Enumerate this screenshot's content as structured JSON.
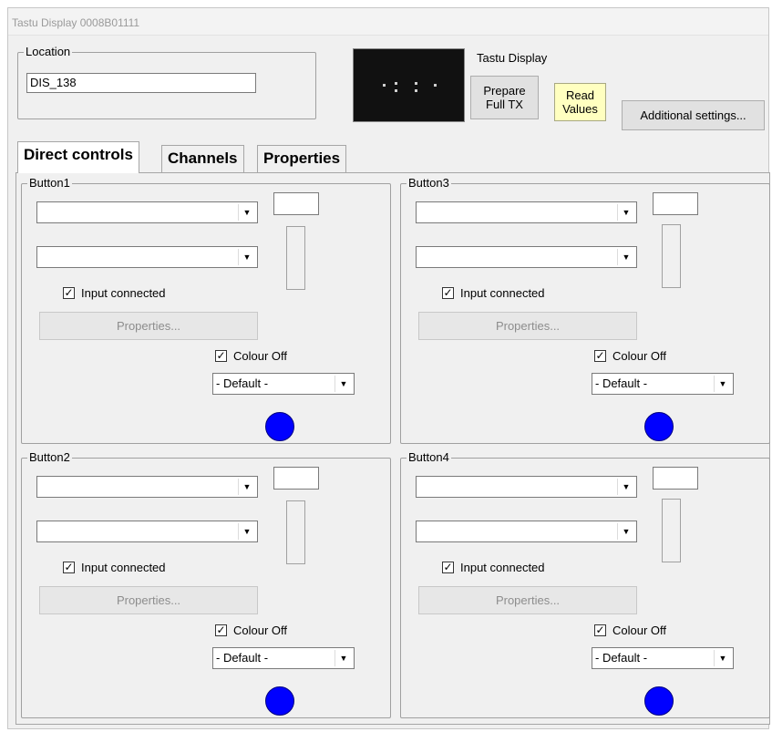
{
  "window": {
    "title": "Tastu Display 0008B01111"
  },
  "location": {
    "group_label": "Location",
    "value": "DIS_138"
  },
  "device": {
    "label": "Tastu Display",
    "prepare_label": "Prepare\nFull TX",
    "read_label": "Read\nValues",
    "additional_label": "Additional settings..."
  },
  "tabs": [
    {
      "label": "Direct controls",
      "active": true
    },
    {
      "label": "Channels",
      "active": false
    },
    {
      "label": "Properties",
      "active": false
    }
  ],
  "buttons": [
    {
      "name": "Button1",
      "combo1": "",
      "combo2": "",
      "input_connected_label": "Input connected",
      "input_connected": true,
      "properties_label": "Properties...",
      "colour_off_label": "Colour Off",
      "colour_off": true,
      "colour_select": "- Default -",
      "led_color": "#0000ff"
    },
    {
      "name": "Button2",
      "combo1": "",
      "combo2": "",
      "input_connected_label": "Input connected",
      "input_connected": true,
      "properties_label": "Properties...",
      "colour_off_label": "Colour Off",
      "colour_off": true,
      "colour_select": "- Default -",
      "led_color": "#0000ff"
    },
    {
      "name": "Button3",
      "combo1": "",
      "combo2": "",
      "input_connected_label": "Input connected",
      "input_connected": true,
      "properties_label": "Properties...",
      "colour_off_label": "Colour Off",
      "colour_off": true,
      "colour_select": "- Default -",
      "led_color": "#0000ff"
    },
    {
      "name": "Button4",
      "combo1": "",
      "combo2": "",
      "input_connected_label": "Input connected",
      "input_connected": true,
      "properties_label": "Properties...",
      "colour_off_label": "Colour Off",
      "colour_off": true,
      "colour_select": "- Default -",
      "led_color": "#0000ff"
    }
  ],
  "colors": {
    "read_button_bg": "#ffffc0",
    "led": "#0000ff",
    "window_bg": "#f0f0f0"
  }
}
